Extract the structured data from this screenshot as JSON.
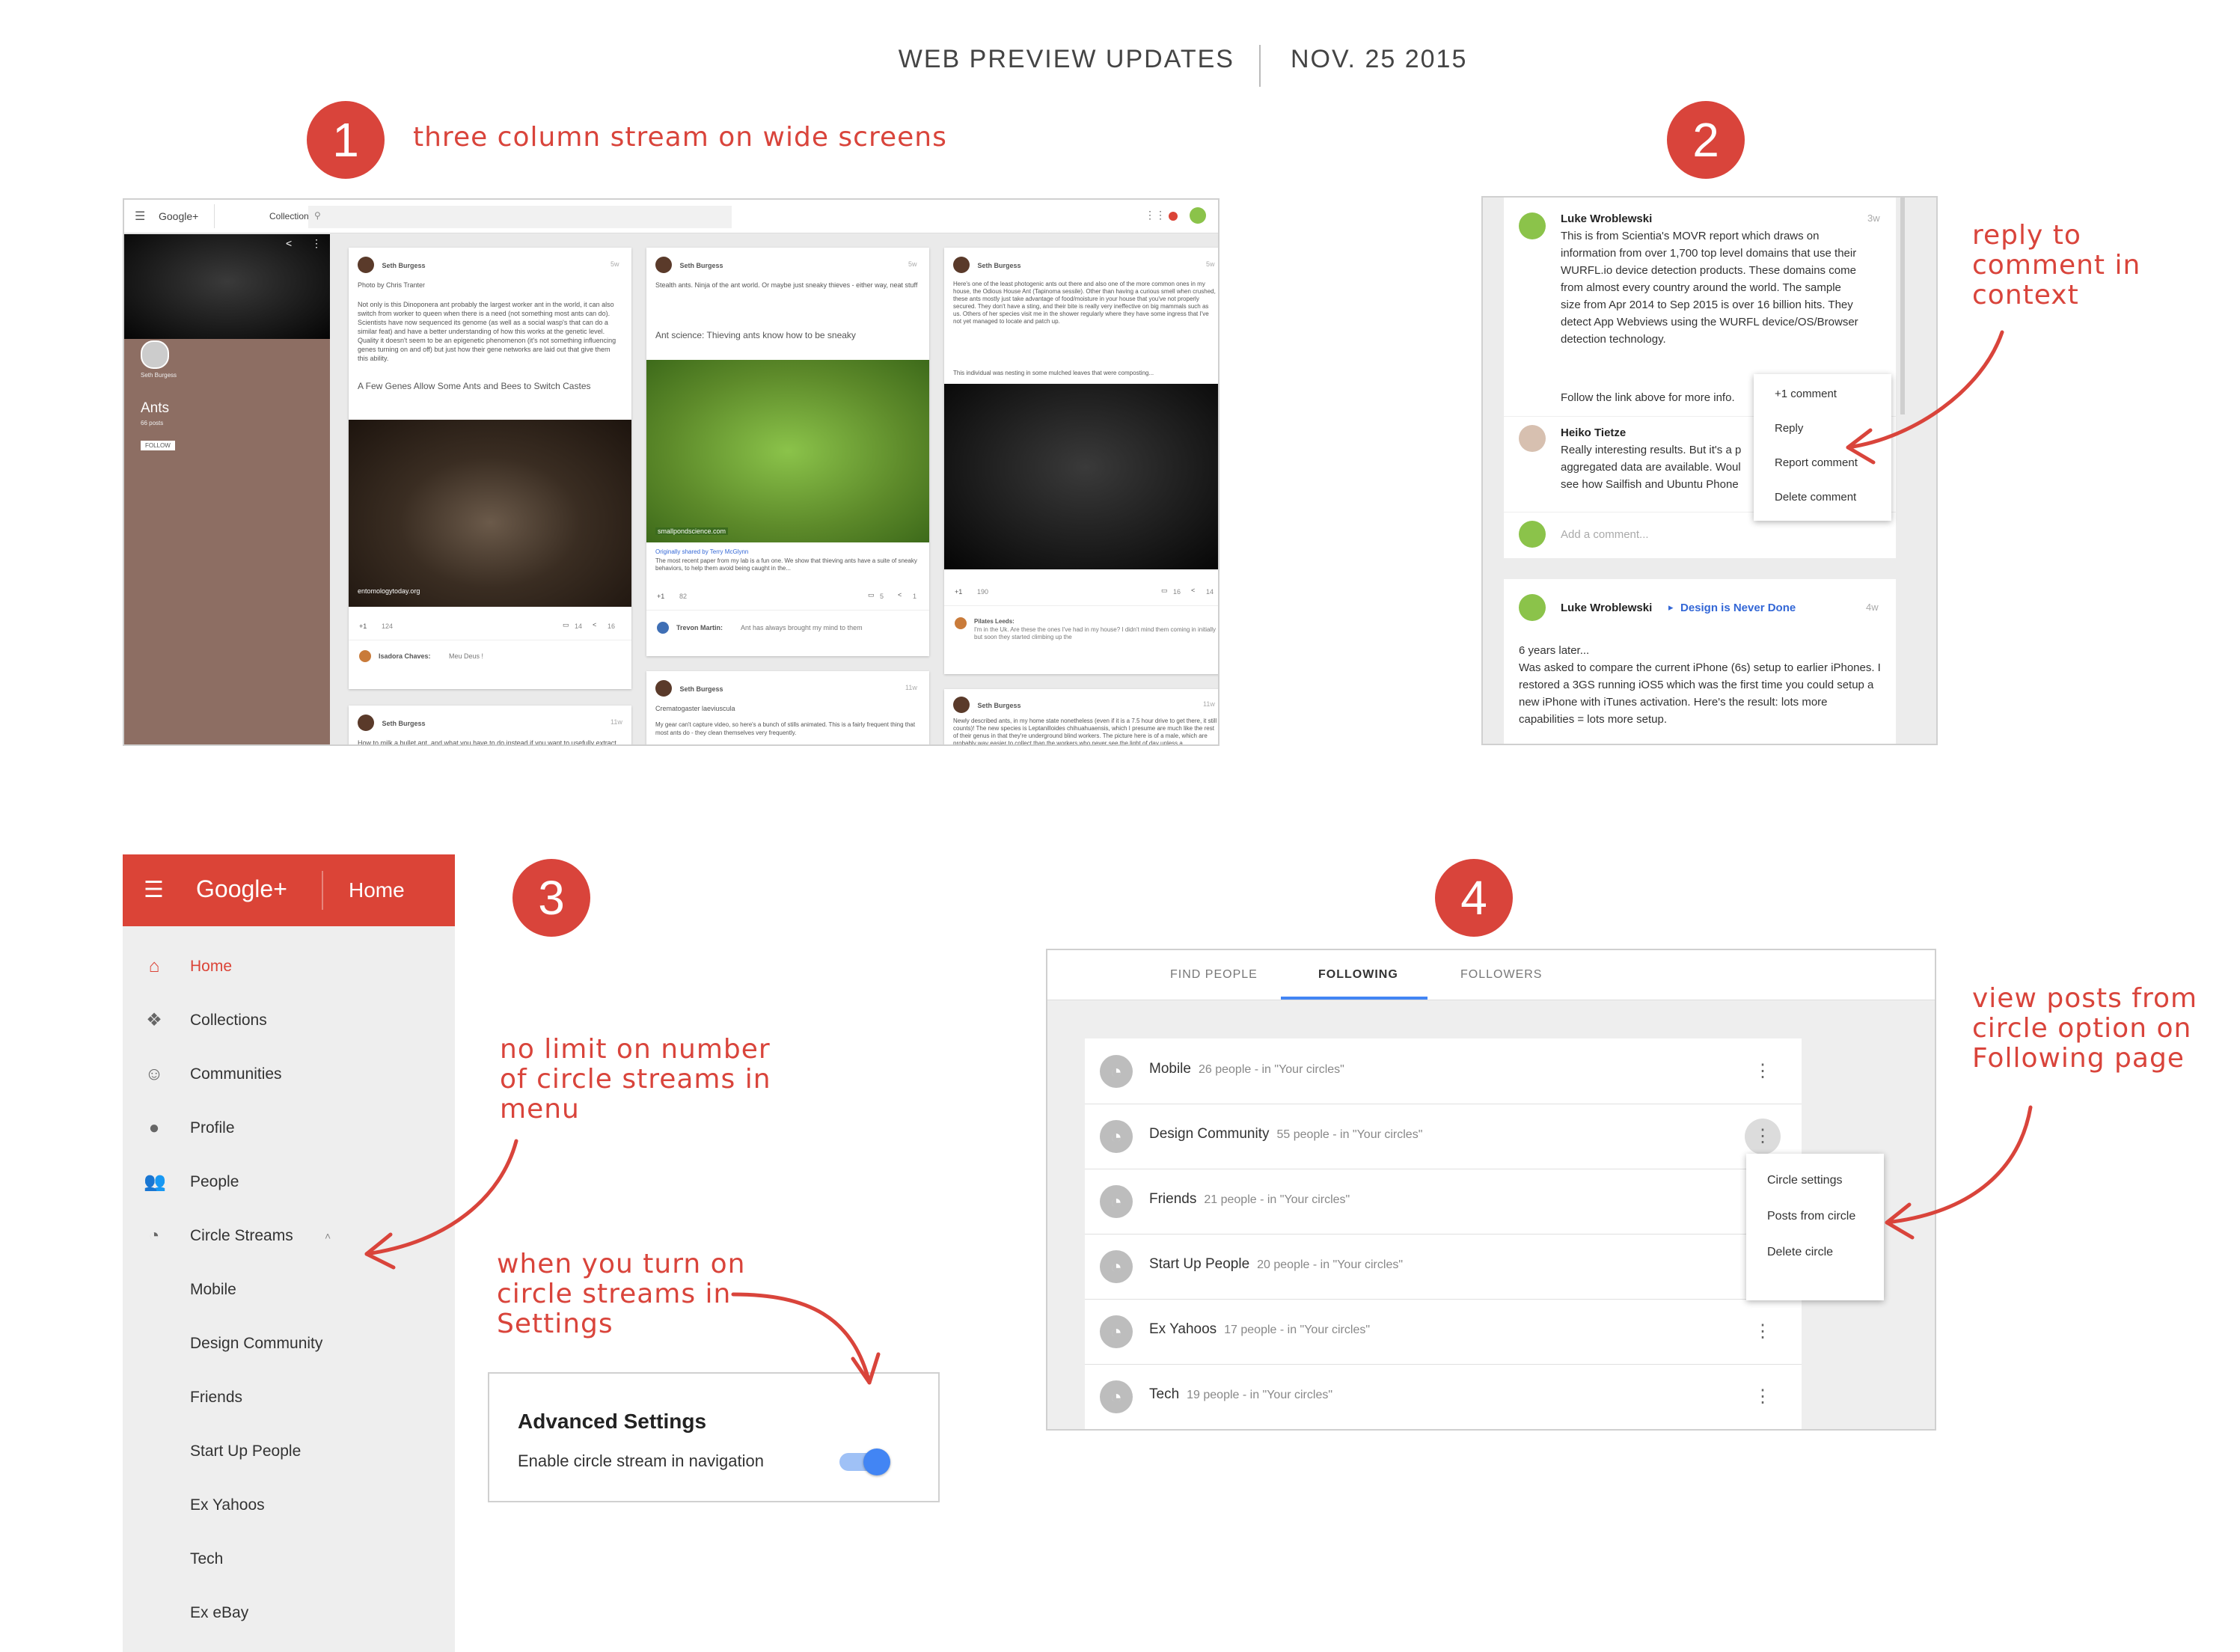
{
  "header": {
    "left": "WEB PREVIEW UPDATES",
    "right": "NOV. 25 2015"
  },
  "sections": [
    {
      "number": "1",
      "note": "three column stream on wide screens"
    },
    {
      "number": "2",
      "note_lines": [
        "reply to",
        "comment in",
        "context"
      ]
    },
    {
      "number": "3",
      "note_lines": [
        "no limit on number",
        "of circle streams in",
        "menu"
      ],
      "note2_lines": [
        "when you turn on",
        "circle streams in",
        "Settings"
      ]
    },
    {
      "number": "4",
      "note_lines": [
        "view posts from",
        "circle option on",
        "Following page"
      ]
    }
  ],
  "panel1": {
    "brand": "Google+",
    "tab": "Collections",
    "collection": {
      "title": "Ants",
      "subtitle": "66 posts",
      "owner": "Seth Burgess",
      "follow": "FOLLOW"
    },
    "cards": [
      {
        "author": "Seth Burgess",
        "time": "5w",
        "text": "Photo by Chris Tranter",
        "body": "Not only is this Dinoponera ant probably the largest worker ant in the world, it can also switch from worker to queen when there is a need (not something most ants can do). Scientists have now sequenced its genome (as well as a social wasp's that can do a similar feat) and have a better understanding of how this works at the genetic level. Quality it doesn't seem to be an epigenetic phenomenon (it's not something influencing genes turning on and off) but just how their gene networks are laid out that give them this ability.",
        "link": "A Few Genes Allow Some Ants and Bees to Switch Castes",
        "image_caption": "entomologytoday.org",
        "plus": "+1",
        "plus_count": "124",
        "comments": "14",
        "shares": "16",
        "comment_author": "Isadora Chaves:",
        "comment_text": "Meu Deus !"
      },
      {
        "author": "Seth Burgess",
        "time": "5w",
        "text": "Stealth ants. Ninja of the ant world. Or maybe just sneaky thieves - either way, neat stuff",
        "link": "Ant science: Thieving ants know how to be sneaky",
        "image_caption": "smallpondscience.com",
        "shared_by": "Originally shared by Terry McGlynn",
        "body": "The most recent paper from my lab is a fun one. We show that thieving ants have a suite of sneaky behaviors, to help them avoid being caught in the...",
        "plus": "+1",
        "plus_count": "82",
        "comments": "5",
        "shares": "1",
        "comment_author": "Trevon Martin:",
        "comment_text": "Ant has always brought my mind to them"
      },
      {
        "author": "Seth Burgess",
        "time": "5w",
        "text": "Here's one of the least photogenic ants out there and also one of the more common ones in my house, the Odious House Ant (Tapinoma sessile). Other than having a curious smell when crushed, these ants mostly just take advantage of food/moisture in your house that you've not properly secured. They don't have a sting, and their bite is really very ineffective on big mammals such as us. Others of her species visit me in the shower regularly where they have some ingress that I've not yet managed to locate and patch up.",
        "body": "This individual was nesting in some mulched leaves that were composting...",
        "plus": "+1",
        "plus_count": "190",
        "comments": "16",
        "shares": "14",
        "comment_author": "Pilates Leeds:",
        "comment_text": "I'm in the Uk. Are these the ones I've had in my house? I didn't mind them coming in initially but soon they started climbing up the"
      },
      {
        "author": "Seth Burgess",
        "time": "11w",
        "text": "How to milk a bullet ant, and what you have to do instead if you want to usefully extract their venom."
      },
      {
        "author": "Seth Burgess",
        "time": "11w",
        "text": "Crematogaster laeviuscula",
        "body": "My gear can't capture video, so here's a bunch of stills animated. This is a fairly frequent thing that most ants do - they clean themselves very frequently."
      },
      {
        "author": "Seth Burgess",
        "time": "11w",
        "text": "Newly described ants, in my home state nonetheless (even if it is a 7.5 hour drive to get there, it still counts)! The new species is Leptanilloides chihuahuaensis, which I presume are much like the rest of their genus in that they're underground blind workers. The picture here is of a male, which are probably way easier to collect than the workers who never see the light of day unless a myrmecologist goes digging (literally). So far this hasn't been done for"
      }
    ]
  },
  "panel2": {
    "comment1": {
      "author": "Luke Wroblewski",
      "time": "3w",
      "text": "This is from Scientia's MOVR report which draws on information from over 1,700 top level domains that use their WURFL.io device detection products. These domains come from almost every country around the world. The sample size from Apr 2014 to Sep 2015 is over 16 billion hits. They detect App Webviews using the WURFL device/OS/Browser detection technology.",
      "follow": "Follow the link above for more info."
    },
    "comment2": {
      "author": "Heiko Tietze",
      "text": "Really interesting results. But it's a p aggregated data are available. Woul see how Sailfish and Ubuntu Phone"
    },
    "add_comment": "Add a comment...",
    "menu": [
      "+1 comment",
      "Reply",
      "Report comment",
      "Delete comment"
    ],
    "post2": {
      "author": "Luke Wroblewski",
      "target": "Design is Never Done",
      "time": "4w",
      "text": "6 years later...\nWas asked to compare the current iPhone (6s) setup to earlier iPhones. I restored a 3GS running iOS5 which was the first time you could setup a new iPhone with iTunes activation. Here's the result: lots more capabilities = lots more setup."
    }
  },
  "panel3": {
    "brand": "Google+",
    "page": "Home",
    "nav": [
      {
        "label": "Home",
        "icon": "home-icon",
        "active": true
      },
      {
        "label": "Collections",
        "icon": "collections-icon"
      },
      {
        "label": "Communities",
        "icon": "communities-icon"
      },
      {
        "label": "Profile",
        "icon": "profile-icon"
      },
      {
        "label": "People",
        "icon": "people-icon"
      },
      {
        "label": "Circle Streams",
        "icon": "circle-streams-icon"
      }
    ],
    "sub": [
      "Mobile",
      "Design Community",
      "Friends",
      "Start Up People",
      "Ex Yahoos",
      "Tech",
      "Ex eBay"
    ],
    "settings": {
      "title": "Advanced Settings",
      "label": "Enable circle stream in navigation",
      "toggle_on": true
    }
  },
  "panel4": {
    "tabs": [
      "FIND PEOPLE",
      "FOLLOWING",
      "FOLLOWERS"
    ],
    "active_tab": "FOLLOWING",
    "circles": [
      {
        "name": "Mobile",
        "meta": "26 people - in \"Your circles\""
      },
      {
        "name": "Design Community",
        "meta": "55 people - in \"Your circles\""
      },
      {
        "name": "Friends",
        "meta": "21 people - in \"Your circles\""
      },
      {
        "name": "Start Up People",
        "meta": "20 people - in \"Your circles\""
      },
      {
        "name": "Ex Yahoos",
        "meta": "17 people - in \"Your circles\""
      },
      {
        "name": "Tech",
        "meta": "19 people - in \"Your circles\""
      }
    ],
    "menu": [
      "Circle settings",
      "Posts from circle",
      "Delete circle"
    ]
  },
  "colors": {
    "accent": "#db4437",
    "annotation": "#d9443b",
    "link": "#3367d6",
    "toggle": "#4285f4"
  }
}
